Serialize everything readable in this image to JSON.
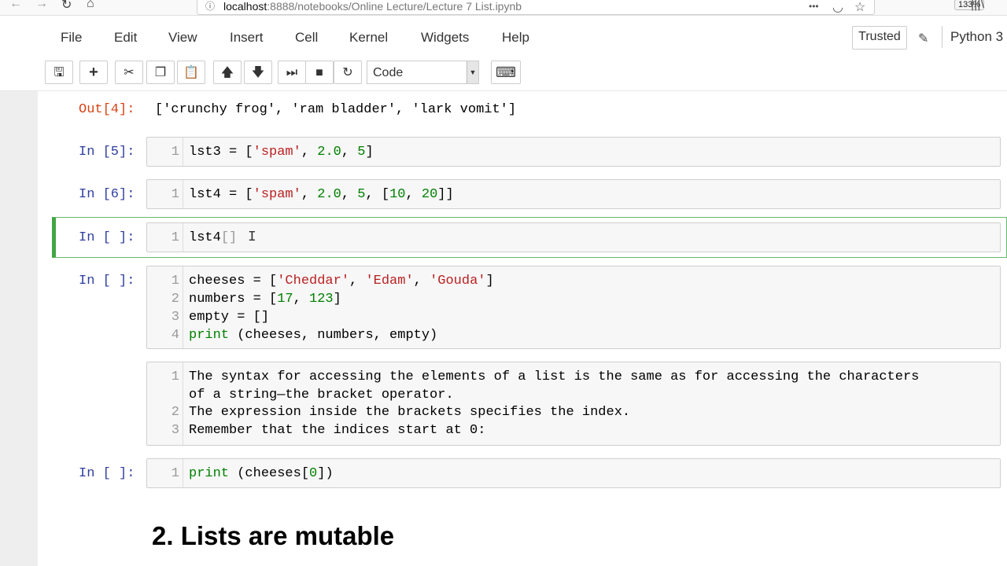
{
  "browser": {
    "back_icon": "←",
    "forward_icon": "→",
    "reload_icon": "↻",
    "home_icon": "⌂",
    "lock_icon": "ⓘ",
    "url_host": "localhost",
    "url_path": ":8888/notebooks/Online Lecture/Lecture 7 List.ipynb",
    "zoom": "133%",
    "more_icon": "•••",
    "pocket_icon": "◡",
    "star_icon": "☆",
    "library_icon": "|||\\"
  },
  "menu": {
    "items": [
      "File",
      "Edit",
      "View",
      "Insert",
      "Cell",
      "Kernel",
      "Widgets",
      "Help"
    ],
    "trusted": "Trusted",
    "kernel": "Python 3"
  },
  "toolbar": {
    "save": "🖫",
    "add": "+",
    "cut": "✂",
    "copy": "❐",
    "paste": "📋",
    "up": "🡅",
    "down": "🡇",
    "run": "⏭",
    "stop": "■",
    "restart": "↻",
    "cell_type": "Code",
    "keyboard": "⌨"
  },
  "cells": {
    "out4": {
      "prompt": "Out[4]:",
      "text": "['crunchy frog', 'ram bladder', 'lark vomit']"
    },
    "in5": {
      "prompt": "In [5]:",
      "line": "1"
    },
    "in6": {
      "prompt": "In [6]:",
      "line": "1"
    },
    "in_active": {
      "prompt": "In [ ]:",
      "line": "1",
      "text": "lst4"
    },
    "in_cheeses": {
      "prompt": "In [ ]:",
      "lines": [
        "1",
        "2",
        "3",
        "4"
      ]
    },
    "raw": {
      "lines": [
        "1",
        "2",
        "3"
      ],
      "l1a": "The syntax for accessing the elements of a list is the same as for accessing the characters",
      "l1b": "of a string—the bracket operator.",
      "l2": "The expression inside the brackets specifies the index.",
      "l3": "Remember that the indices start at 0:"
    },
    "in_print": {
      "prompt": "In [ ]:",
      "line": "1"
    }
  },
  "heading": "2. Lists are mutable"
}
